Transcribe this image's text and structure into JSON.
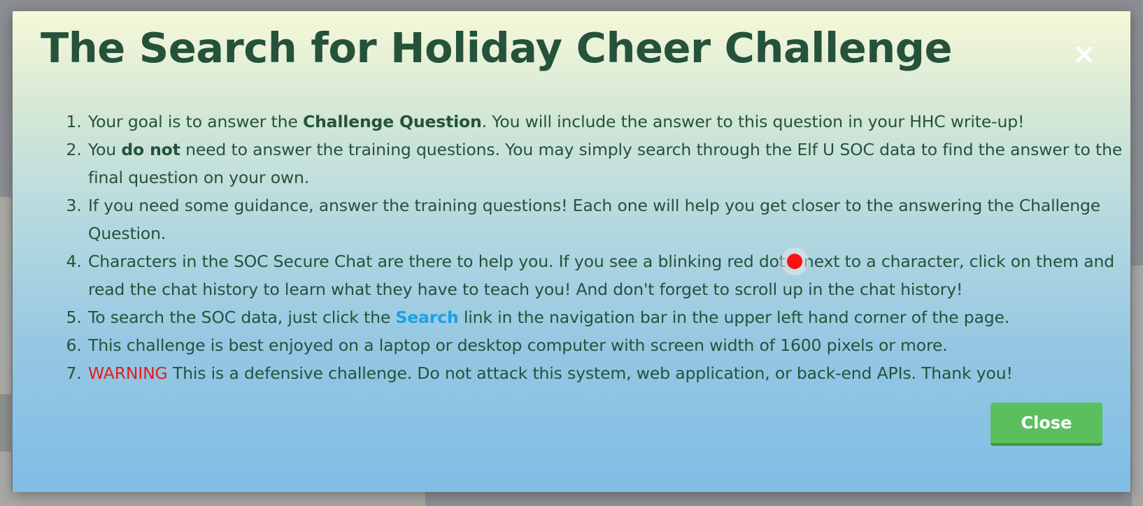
{
  "modal": {
    "title": "The Search for Holiday Cheer Challenge",
    "close_icon": "close-icon",
    "close_button_label": "Close",
    "rules": [
      {
        "pre": "Your goal is to answer the ",
        "bold": "Challenge Question",
        "post": ". You will include the answer to this question in your HHC write-up!"
      },
      {
        "pre": "You ",
        "bold": "do not",
        "post": " need to answer the training questions. You may simply search through the Elf U SOC data to find the answer to the final question on your own."
      },
      {
        "text": "If you need some guidance, answer the training questions! Each one will help you get closer to the answering the Challenge Question."
      },
      {
        "pre": "Characters in the SOC Secure Chat are there to help you. If you see a blinking red dot",
        "dot_icon": "red-dot-icon",
        "post": "next to a character, click on them and read the chat history to learn what they have to teach you! And don't forget to scroll up in the chat history!"
      },
      {
        "pre": "To search the SOC data, just click the ",
        "link": "Search",
        "post": " link in the navigation bar in the upper left hand corner of the page."
      },
      {
        "text": "This challenge is best enjoyed on a laptop or desktop computer with screen width of 1600 pixels or more."
      },
      {
        "warning": "WARNING",
        "post": " This is a defensive challenge. Do not attack this system, web application, or back-end APIs. Thank you!"
      }
    ]
  },
  "colors": {
    "title": "#24523a",
    "body_text": "#24523a",
    "link": "#1aa0e6",
    "warning": "#e81a1a",
    "red_dot": "#ff0f0f",
    "close_button": "#5cbf5e",
    "gradient_top": "#f7f8d8",
    "gradient_bottom": "#7fbde5"
  }
}
